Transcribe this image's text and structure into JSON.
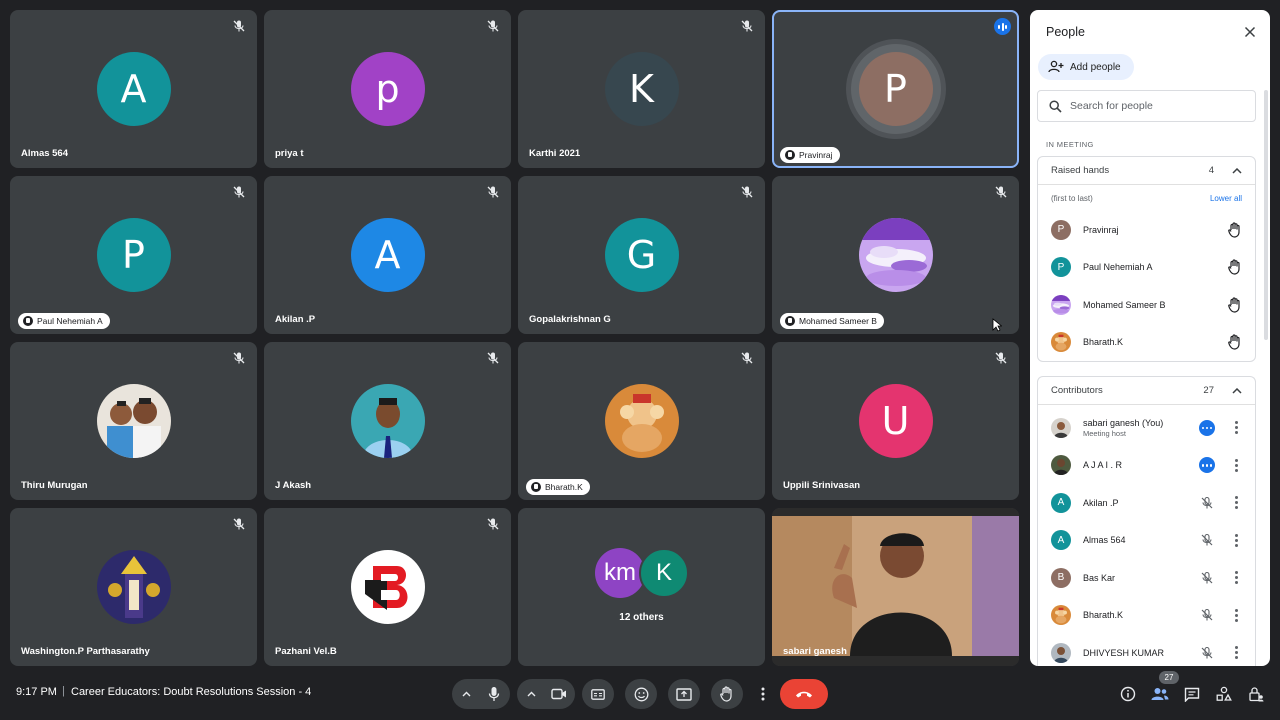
{
  "tiles": [
    {
      "name": "Almas 564",
      "initial": "A",
      "color": "#12939a",
      "muted": true
    },
    {
      "name": "priya t",
      "initial": "p",
      "color": "#a142c6",
      "muted": true
    },
    {
      "name": "Karthi 2021",
      "initial": "K",
      "color": "#37474f",
      "muted": true
    },
    {
      "name": "Pravinraj",
      "initial": "P",
      "color": "#8d6e63",
      "hand": true,
      "speaking": true
    },
    {
      "name": "Paul Nehemiah A",
      "initial": "P",
      "color": "#12939a",
      "muted": true,
      "hand": true
    },
    {
      "name": "Akilan .P",
      "initial": "A",
      "color": "#1e88e5",
      "muted": true
    },
    {
      "name": "Gopalakrishnan G",
      "initial": "G",
      "color": "#12939a",
      "muted": true
    },
    {
      "name": "Mohamed Sameer B",
      "photo": "clouds",
      "muted": true,
      "hand": true
    },
    {
      "name": "Thiru Murugan",
      "photo": "kids",
      "muted": true
    },
    {
      "name": "J Akash",
      "photo": "boy",
      "muted": true
    },
    {
      "name": "Bharath.K",
      "photo": "ganesh",
      "muted": true,
      "hand": true
    },
    {
      "name": "Uppili Srinivasan",
      "initial": "U",
      "color": "#e4346f",
      "muted": true
    },
    {
      "name": "Washington.P Parthasarathy",
      "photo": "deity",
      "muted": true
    },
    {
      "name": "Pazhani Vel.B",
      "photo": "logo",
      "muted": true
    },
    {
      "others": "12 others",
      "bubbles": [
        {
          "t": "km",
          "color": "#8e44c4"
        },
        {
          "t": "K",
          "color": "#0f8a73"
        }
      ]
    },
    {
      "name": "sabari ganesh",
      "photo": "video"
    }
  ],
  "panel": {
    "title": "People",
    "add_people": "Add people",
    "search_placeholder": "Search for people",
    "in_meeting": "IN MEETING",
    "raised": {
      "title": "Raised hands",
      "count": "4",
      "order": "(first to last)",
      "lower_all": "Lower all"
    },
    "raised_people": [
      {
        "name": "Pravinraj",
        "initial": "P",
        "color": "#8d6e63"
      },
      {
        "name": "Paul Nehemiah A",
        "initial": "P",
        "color": "#12939a"
      },
      {
        "name": "Mohamed Sameer B",
        "photo": "clouds"
      },
      {
        "name": "Bharath.K",
        "photo": "ganesh"
      }
    ],
    "contributors": {
      "title": "Contributors",
      "count": "27"
    },
    "contributor_people": [
      {
        "name": "sabari ganesh (You)",
        "sub": "Meeting host",
        "photo": "face",
        "state": "more"
      },
      {
        "name": "A J A I . R",
        "photo": "face2",
        "state": "more"
      },
      {
        "name": "Akilan .P",
        "initial": "A",
        "color": "#12939a",
        "state": "muted"
      },
      {
        "name": "Almas 564",
        "initial": "A",
        "color": "#12939a",
        "state": "muted"
      },
      {
        "name": "Bas Kar",
        "initial": "B",
        "color": "#8d6e63",
        "state": "muted"
      },
      {
        "name": "Bharath.K",
        "photo": "ganesh",
        "state": "muted"
      },
      {
        "name": "DHIVYESH KUMAR",
        "photo": "face3",
        "state": "muted"
      }
    ]
  },
  "bottom": {
    "time": "9:17 PM",
    "separator": "|",
    "meeting_title": "Career Educators: Doubt Resolutions Session - 4",
    "participant_count": "27"
  }
}
